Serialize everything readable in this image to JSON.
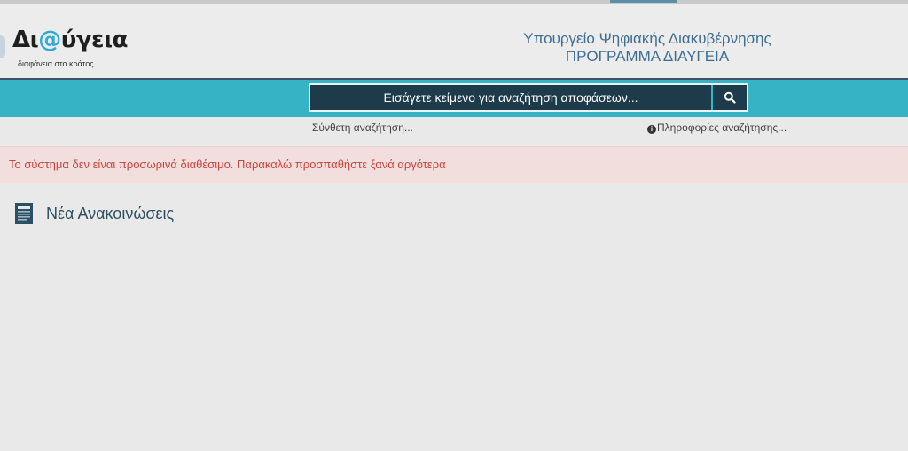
{
  "header": {
    "logo": {
      "title_prefix": "Δι",
      "title_at": "@",
      "title_suffix": "ύγεια",
      "subtitle": "διαφάνεια στο κράτος"
    },
    "ministry_line1": "Υπουργείο Ψηφιακής Διακυβέρνησης",
    "ministry_line2": "ΠΡΟΓΡΑΜΜΑ ΔΙΑΥΓΕΙΑ"
  },
  "search": {
    "placeholder": "Εισάγετε κείμενο για αναζήτηση αποφάσεων...",
    "button_icon": "search-icon"
  },
  "links": {
    "advanced_search": "Σύνθετη αναζήτηση...",
    "search_info": "Πληροφορίες αναζήτησης...",
    "info_icon": "info-icon"
  },
  "alert": {
    "message": "Το σύστημα δεν είναι προσωρινά διαθέσιμο. Παρακαλώ προσπαθήστε ξανά αργότερα"
  },
  "announcements": {
    "title": "Νέα Ανακοινώσεις",
    "icon": "newspaper-icon"
  },
  "colors": {
    "accent": "#37b3c6",
    "dark": "#1d3b4b",
    "ministry_text": "#3d6e93",
    "alert_bg": "#f3dede",
    "alert_text": "#c6473f"
  }
}
